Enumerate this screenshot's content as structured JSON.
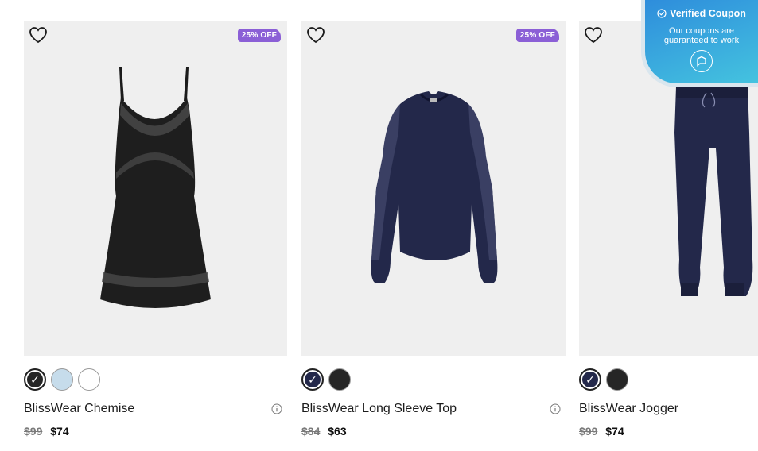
{
  "products": [
    {
      "badge": "25% OFF",
      "name": "BlissWear Chemise",
      "old_price": "$99",
      "new_price": "$74",
      "swatches": [
        "#262626",
        "#c6dceb",
        "#ffffff"
      ]
    },
    {
      "badge": "25% OFF",
      "name": "BlissWear Long Sleeve Top",
      "old_price": "$84",
      "new_price": "$63",
      "swatches": [
        "#23284a",
        "#262626"
      ]
    },
    {
      "badge": "",
      "name": "BlissWear Jogger",
      "old_price": "$99",
      "new_price": "$74",
      "swatches": [
        "#23284a",
        "#262626"
      ]
    }
  ],
  "coupon": {
    "title": "Verified Coupon",
    "subtitle_line1": "Our coupons are",
    "subtitle_line2": "guaranteed to work"
  },
  "colors": {
    "badge": "#8b5fd6",
    "coupon_gradient_start": "#2e8ddc",
    "coupon_gradient_end": "#44c3df",
    "image_bg": "#efefef"
  }
}
